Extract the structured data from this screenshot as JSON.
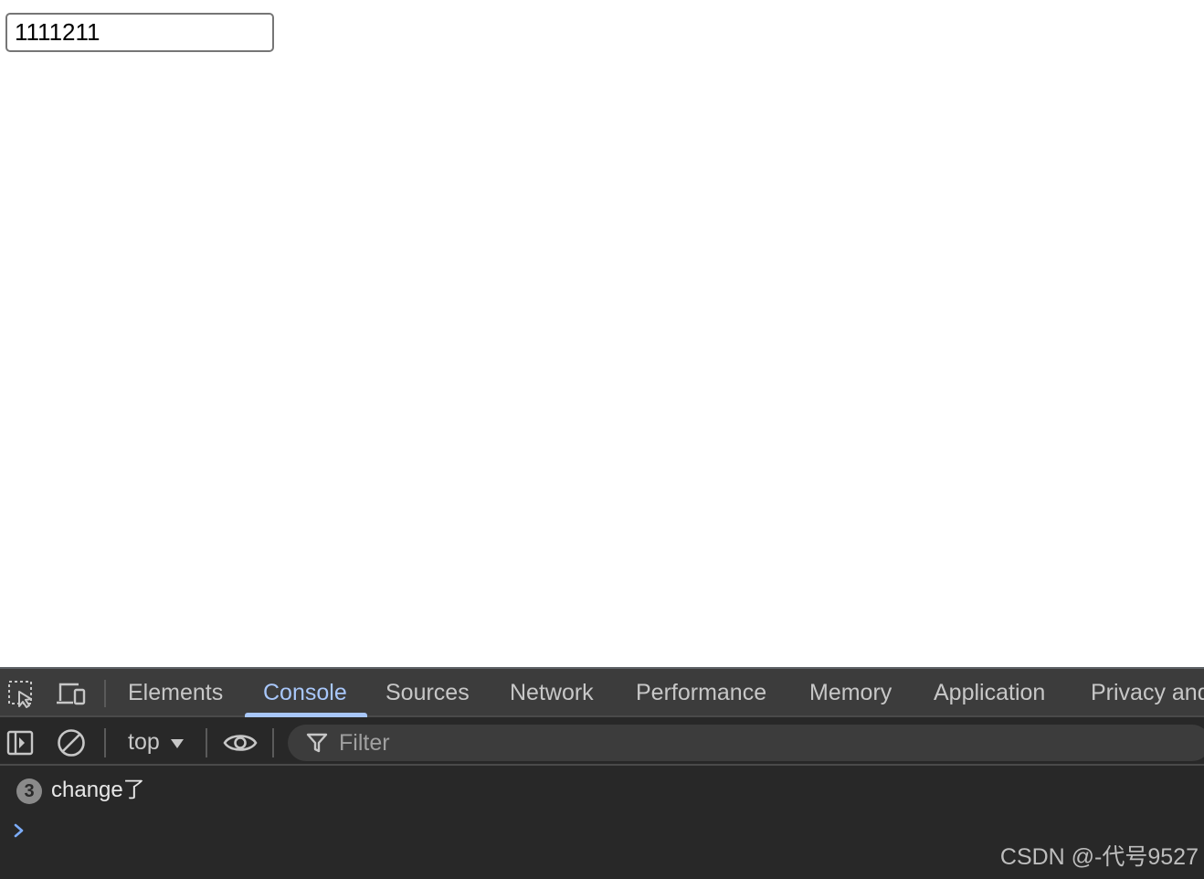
{
  "page": {
    "input_value": "1111211"
  },
  "devtools": {
    "tabs": [
      {
        "label": "Elements"
      },
      {
        "label": "Console"
      },
      {
        "label": "Sources"
      },
      {
        "label": "Network"
      },
      {
        "label": "Performance"
      },
      {
        "label": "Memory"
      },
      {
        "label": "Application"
      },
      {
        "label": "Privacy and"
      }
    ],
    "active_tab": "Console",
    "accent_color": "#a8c7fa",
    "context": "top",
    "filter_placeholder": "Filter",
    "console": {
      "messages": [
        {
          "count": "3",
          "text": "change了"
        }
      ]
    },
    "icons": [
      "inspect-element-icon",
      "device-toolbar-icon",
      "sidebar-toggle-icon",
      "clear-console-icon",
      "dropdown-caret-icon",
      "eye-icon",
      "filter-icon",
      "prompt-chevron-icon"
    ]
  },
  "watermark": "CSDN @-代号9527"
}
